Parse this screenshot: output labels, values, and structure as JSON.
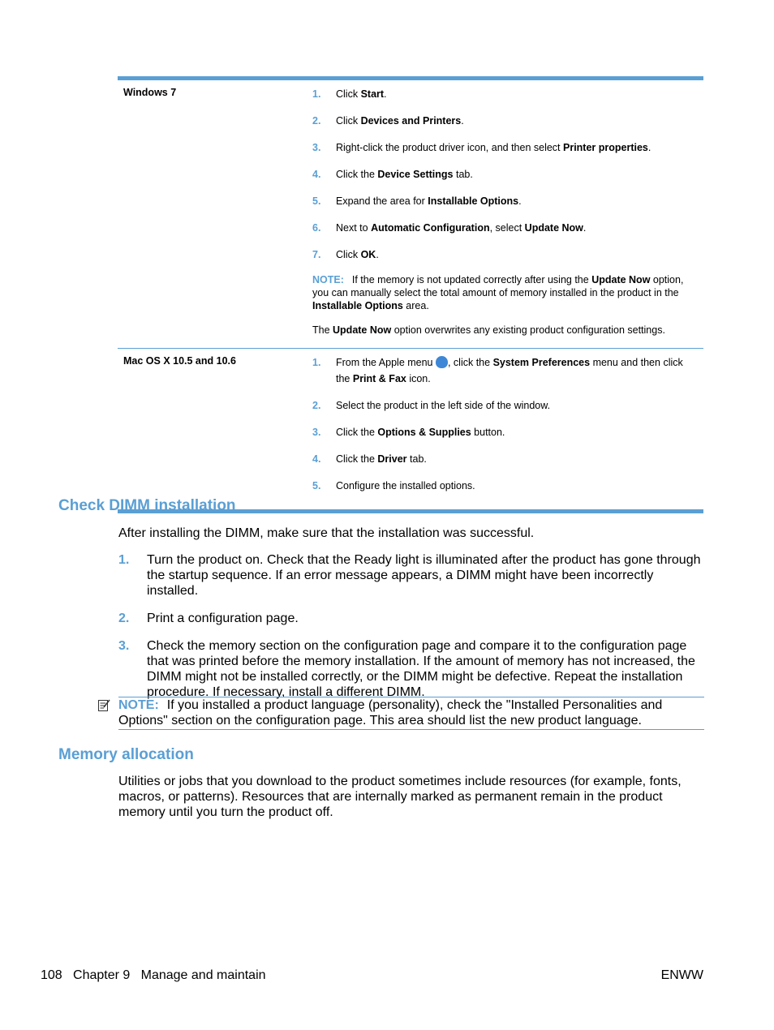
{
  "table": {
    "rows": [
      {
        "os": "Windows 7",
        "steps": [
          {
            "num": "1.",
            "html": "Click <b>Start</b>."
          },
          {
            "num": "2.",
            "html": "Click <b>Devices and Printers</b>."
          },
          {
            "num": "3.",
            "html": "Right-click the product driver icon, and then select <b>Printer properties</b>."
          },
          {
            "num": "4.",
            "html": "Click the <b>Device Settings</b> tab."
          },
          {
            "num": "5.",
            "html": "Expand the area for <b>Installable Options</b>."
          },
          {
            "num": "6.",
            "html": "Next to <b>Automatic Configuration</b>, select <b>Update Now</b>."
          },
          {
            "num": "7.",
            "html": "Click <b>OK</b>."
          }
        ],
        "note_label": "NOTE:",
        "note_html": "If the memory is not updated correctly after using the <b>Update Now</b> option, you can manually select the total amount of memory installed in the product in the <b>Installable Options</b> area.",
        "extra_html": "The <b>Update Now</b> option overwrites any existing product configuration settings."
      },
      {
        "os": "Mac OS X 10.5 and 10.6",
        "steps": [
          {
            "num": "1.",
            "html": "From the Apple menu <span class=\"apple\" data-name=\"apple-icon\" data-interactable=\"false\"></span>, click the <b>System Preferences</b> menu and then click the <b>Print &amp; Fax</b> icon."
          },
          {
            "num": "2.",
            "html": "Select the product in the left side of the window."
          },
          {
            "num": "3.",
            "html": "Click the <b>Options &amp; Supplies</b> button."
          },
          {
            "num": "4.",
            "html": "Click the <b>Driver</b> tab."
          },
          {
            "num": "5.",
            "html": "Configure the installed options."
          }
        ]
      }
    ]
  },
  "section1": {
    "title": "Check DIMM installation",
    "intro": "After installing the DIMM, make sure that the installation was successful.",
    "items": [
      {
        "num": "1.",
        "text": "Turn the product on. Check that the Ready light is illuminated after the product has gone through the startup sequence. If an error message appears, a DIMM might have been incorrectly installed."
      },
      {
        "num": "2.",
        "text": "Print a configuration page."
      },
      {
        "num": "3.",
        "text": "Check the memory section on the configuration page and compare it to the configuration page that was printed before the memory installation. If the amount of memory has not increased, the DIMM might not be installed correctly, or the DIMM might be defective. Repeat the installation procedure. If necessary, install a different DIMM."
      }
    ],
    "note_label": "NOTE:",
    "note_text": "If you installed a product language (personality), check the \"Installed Personalities and Options\" section on the configuration page. This area should list the new product language."
  },
  "section2": {
    "title": "Memory allocation",
    "text": "Utilities or jobs that you download to the product sometimes include resources (for example, fonts, macros, or patterns). Resources that are internally marked as permanent remain in the product memory until you turn the product off."
  },
  "footer": {
    "left": "108   Chapter 9   Manage and maintain",
    "right": "ENWW"
  }
}
